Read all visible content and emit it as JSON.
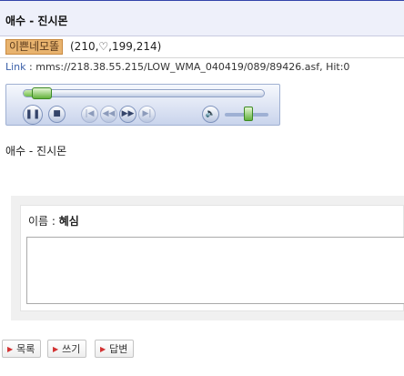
{
  "post": {
    "title": "애수 - 진시몬",
    "author_name": "이쁜네모똘",
    "author_meta": "(210,♡,199,214)",
    "link_label": "Link",
    "link_value": " : mms://218.38.55.215/LOW_WMA_040419/089/89426.asf, Hit:0",
    "body": "애수 - 진시몬"
  },
  "player": {
    "seek_progress": 0.03,
    "volume_level": 0.55,
    "controls": [
      {
        "icon": "pause-icon",
        "glyph": "❚❚"
      },
      {
        "icon": "stop-icon",
        "glyph": "■"
      },
      {
        "icon": "previous-icon",
        "glyph": "|◀"
      },
      {
        "icon": "rewind-icon",
        "glyph": "◀◀"
      },
      {
        "icon": "fast-forward-icon",
        "glyph": "▶▶"
      },
      {
        "icon": "next-icon",
        "glyph": "▶|"
      },
      {
        "icon": "speaker-icon",
        "glyph": "🔈"
      }
    ]
  },
  "comment": {
    "name_label": "이름 : ",
    "name_value": "혜심",
    "textarea_value": ""
  },
  "buttons": {
    "list": "목록",
    "write": "쓰기",
    "reply": "답변"
  },
  "colors": {
    "title_bg": "#eef0fa",
    "author_badge": "#e8b36e",
    "link_label": "#3a5fa8",
    "button_arrow": "#d23232"
  }
}
